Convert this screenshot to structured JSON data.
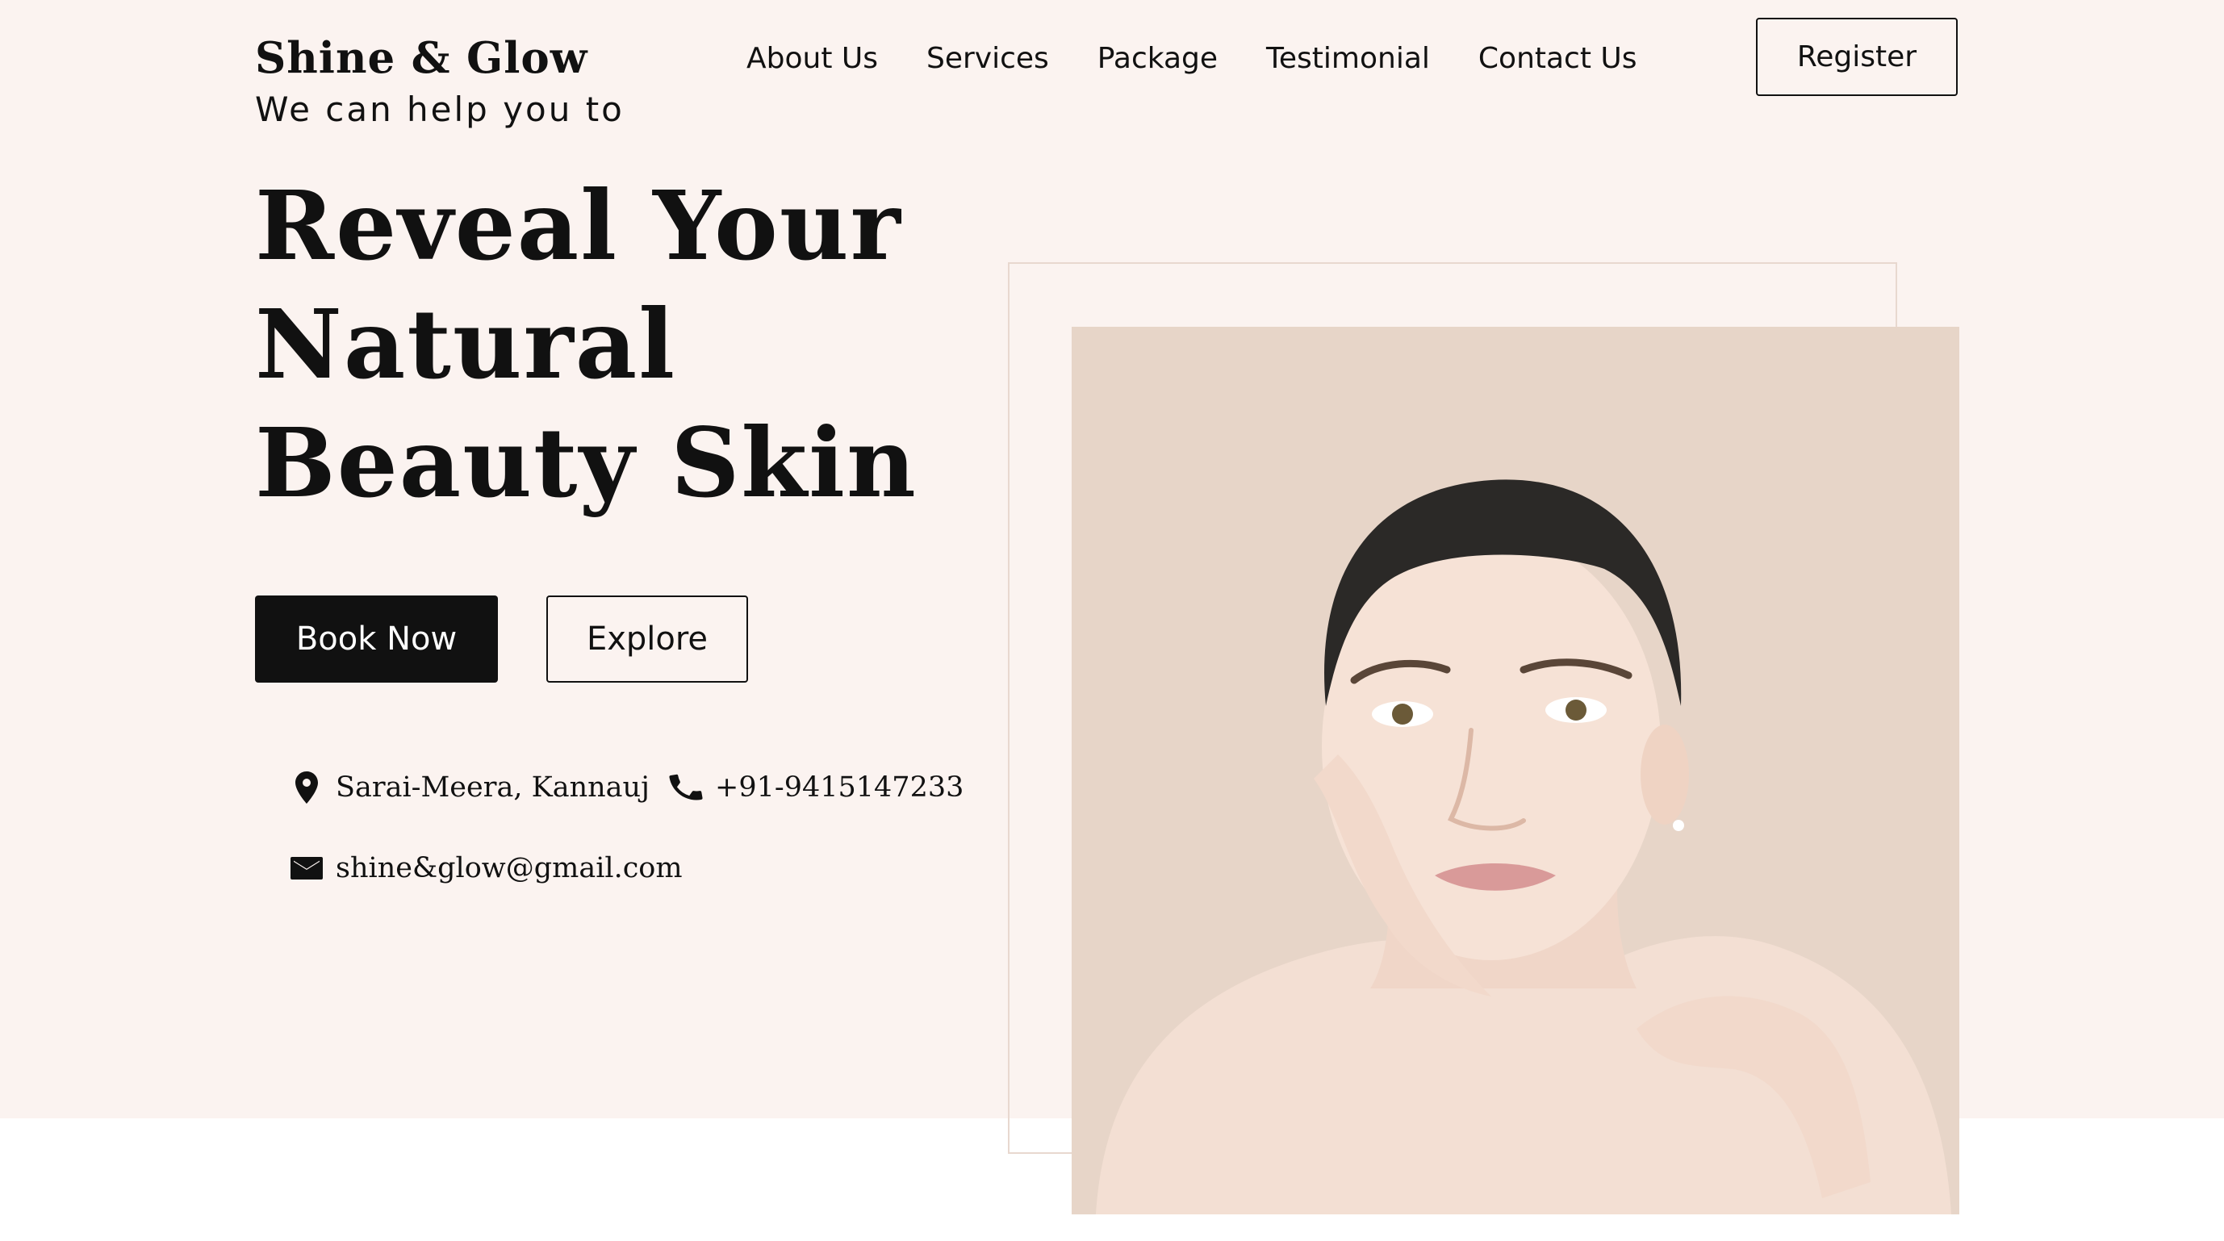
{
  "brand": {
    "name": "Shine & Glow",
    "tagline": "We can help you to"
  },
  "nav": {
    "items": [
      "About Us",
      "Services",
      "Package",
      "Testimonial",
      "Contact Us"
    ],
    "register": "Register"
  },
  "hero": {
    "headline": [
      "Reveal Your",
      "Natural",
      "Beauty Skin"
    ],
    "book_label": "Book Now",
    "explore_label": "Explore"
  },
  "contact": {
    "address": "Sarai-Meera, Kannauj",
    "phone": "+91-9415147233",
    "email": "shine&glow@gmail.com"
  },
  "icons": {
    "address": "map-pin-icon",
    "phone": "phone-icon",
    "email": "envelope-icon"
  },
  "colors": {
    "hero_background": "#fbf3f0",
    "primary_button": "#111111",
    "photo_background": "#e7d5c8",
    "frame_border": "#e8d8cf"
  }
}
